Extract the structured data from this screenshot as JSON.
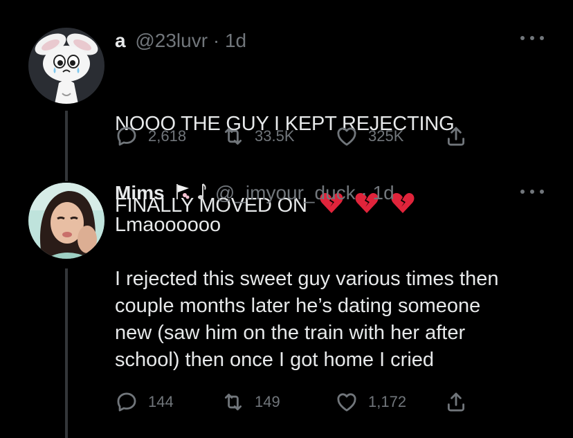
{
  "tweet1": {
    "display_name": "a",
    "handle": "@23luvr",
    "separator": "·",
    "time": "1d",
    "text_line1": "NOOO THE GUY I KEPT REJECTING",
    "text_line2": "FINALLY MOVED ON",
    "emojis": [
      "broken-heart",
      "broken-heart",
      "broken-heart"
    ],
    "replies": "2,618",
    "retweets": "33.5K",
    "likes": "325K"
  },
  "tweet2": {
    "display_name": "Mims",
    "name_emojis": [
      "cherry-blossom-flag",
      "music-note"
    ],
    "handle": "@_imyour_duck",
    "separator": "·",
    "time": "1d",
    "text": "Lmaoooooo\n\nI rejected this sweet guy various times then\ncouple months later he’s dating someone\nnew (saw him on the train with her after\nschool) then once I got home I cried",
    "replies": "144",
    "retweets": "149",
    "likes": "1,172"
  },
  "colors": {
    "background": "#000000",
    "primary_text": "#e7e9ea",
    "secondary_text": "#71767b",
    "thread_line": "#333639",
    "broken_heart": "#e0243b"
  },
  "icons": [
    "reply-icon",
    "retweet-icon",
    "like-icon",
    "share-icon",
    "more-icon"
  ]
}
